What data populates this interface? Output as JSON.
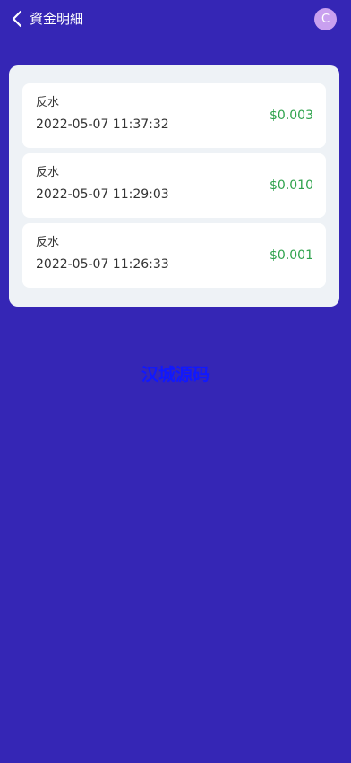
{
  "header": {
    "back_icon": "chevron-left-icon",
    "title": "資金明細",
    "avatar_letter": "C"
  },
  "records": [
    {
      "type": "反水",
      "time": "2022-05-07 11:37:32",
      "amount": "$0.003"
    },
    {
      "type": "反水",
      "time": "2022-05-07 11:29:03",
      "amount": "$0.010"
    },
    {
      "type": "反水",
      "time": "2022-05-07 11:26:33",
      "amount": "$0.001"
    }
  ],
  "watermark": "汉城源码",
  "colors": {
    "background": "#3526b5",
    "card_background": "#eef2f6",
    "amount": "#2fa34d",
    "avatar": "#c9a0ef",
    "watermark": "#1018ff"
  }
}
